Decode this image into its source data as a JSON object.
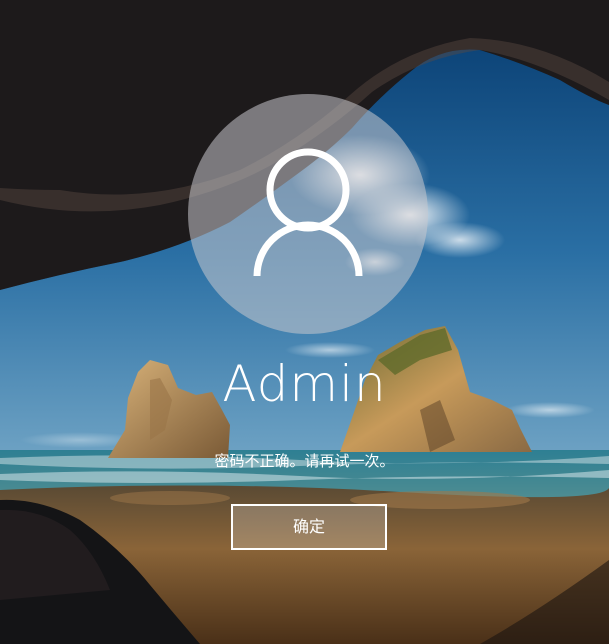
{
  "login": {
    "username": "Admin",
    "error_message": "密码不正确。请再试一次。",
    "ok_button_label": "确定",
    "avatar_icon": "user-icon"
  },
  "colors": {
    "sky": "#1d5a92",
    "sea": "#2f7a90",
    "sand": "#7a5a32",
    "rock": "#141416",
    "text": "#ffffff"
  }
}
